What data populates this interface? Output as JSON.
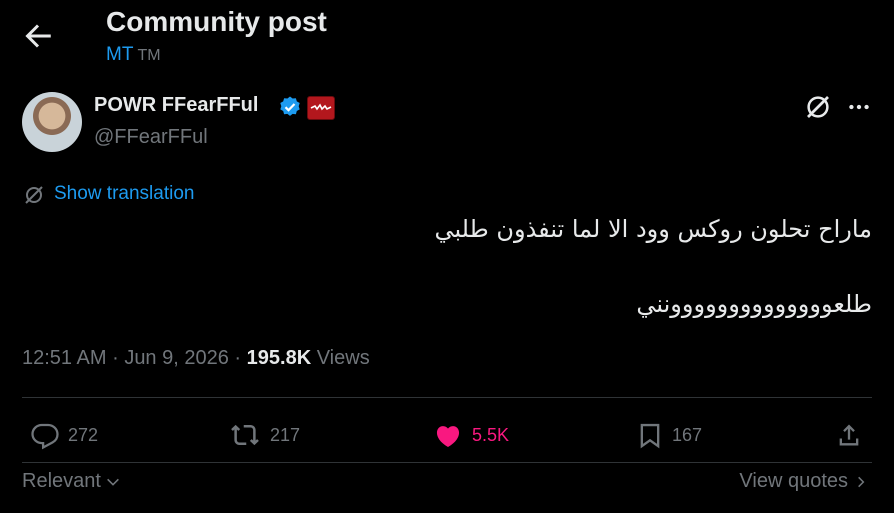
{
  "header": {
    "title": "Community post",
    "subtitle": "MT",
    "subtitle_suffix": "TM"
  },
  "author": {
    "name": "POWR FFearFFul",
    "handle": "@FFearFFul"
  },
  "translation": {
    "label": "Show translation"
  },
  "post": {
    "line1": "ماراح تحلون روكس وود الا لما تنفذون طلبي",
    "line2": "طلعوووووووووووووونني"
  },
  "meta": {
    "time": "12:51 AM",
    "sep1": "·",
    "date": "Jun 9, 2026",
    "sep2": "·",
    "views_count": "195.8K",
    "views_label": "Views"
  },
  "actions": {
    "reply_count": "272",
    "repost_count": "217",
    "like_count": "5.5K",
    "bookmark_count": "167"
  },
  "footer": {
    "sort_label": "Relevant",
    "view_quotes": "View quotes"
  },
  "colors": {
    "background": "#000000",
    "text": "#e7e9ea",
    "muted": "#71767b",
    "accent": "#1d9bf0",
    "like": "#f91880"
  }
}
